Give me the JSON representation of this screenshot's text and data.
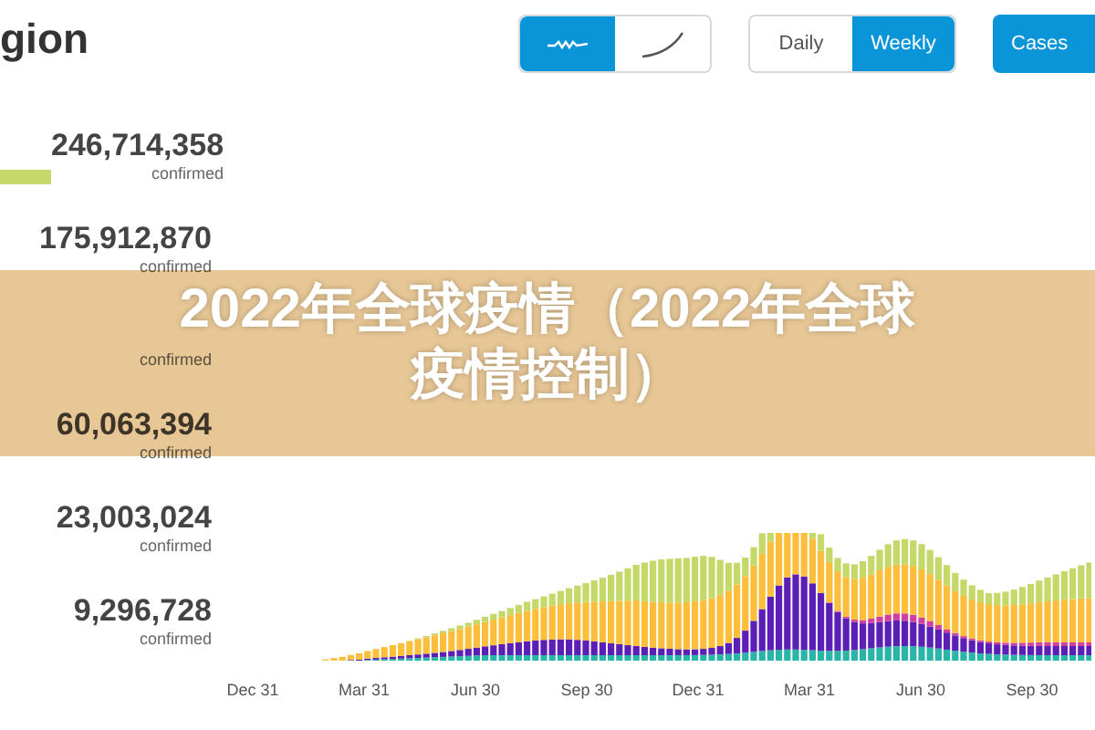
{
  "header": {
    "title": "gion"
  },
  "view_toggle": [
    {
      "kind": "wave",
      "selected": true
    },
    {
      "kind": "curve",
      "selected": false
    }
  ],
  "period_tabs": [
    {
      "label": "Daily",
      "selected": false
    },
    {
      "label": "Weekly",
      "selected": true
    }
  ],
  "metric_button": {
    "label": "Cases"
  },
  "stats": [
    {
      "value": "246,714,358",
      "label": "confirmed",
      "bar": true
    },
    {
      "value": "175,912,870",
      "label": "confirmed",
      "bar": false
    },
    {
      "label": "confirmed",
      "bar": false
    },
    {
      "value": "60,063,394",
      "label": "confirmed",
      "bar": false
    },
    {
      "value": "23,003,024",
      "label": "confirmed",
      "bar": false
    },
    {
      "value": "9,296,728",
      "label": "confirmed",
      "bar": false
    }
  ],
  "chart": {
    "x_labels": [
      "Dec 31",
      "Mar 31",
      "Jun 30",
      "Sep 30",
      "Dec 31",
      "Mar 31",
      "Jun 30",
      "Sep 30"
    ]
  },
  "banner": {
    "title_lines": [
      "2022年全球疫情（2022年全球",
      "疫情控制）"
    ]
  }
}
